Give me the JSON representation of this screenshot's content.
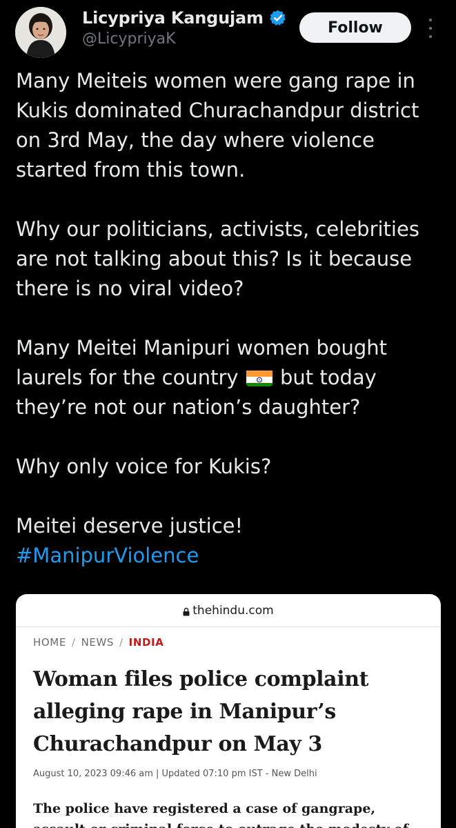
{
  "author": {
    "name": "Licypriya Kangujam",
    "handle": "@LicypriyaK",
    "verified_color": "#1d9bf0"
  },
  "actions": {
    "follow_label": "Follow"
  },
  "tweet": {
    "paragraph1": "Many Meiteis women were gang rape in Kukis dominated Churachandpur district on 3rd May, the day where violence started from this town.",
    "paragraph2": "Why our politicians, activists, celebrities are not talking about this? Is it because there is no viral video?",
    "paragraph3_before_flag": "Many Meitei Manipuri women bought laurels for the country",
    "paragraph3_after_flag": "but today they’re not our nation’s daughter?",
    "paragraph4": "Why only voice for Kukis?",
    "paragraph5": "Meitei deserve justice!",
    "hashtag": "#ManipurViolence",
    "hashtag_color": "#1d9bf0"
  },
  "embedded_article": {
    "domain": "thehindu.com",
    "breadcrumb": [
      "HOME",
      "NEWS",
      "INDIA"
    ],
    "breadcrumb_separator": "/",
    "breadcrumb_active_color": "#c41a1a",
    "headline": "Woman files police complaint alleging rape in Manipur’s Churachandpur on May 3",
    "dateline": "August 10, 2023 09:46 am | Updated 07:10 pm IST - New Delhi",
    "lede": "The police have registered a case of gangrape, assault or criminal force to outrage the modesty of"
  }
}
